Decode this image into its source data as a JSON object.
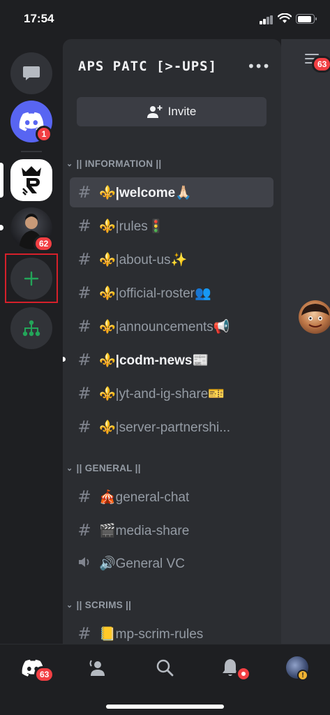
{
  "status_bar": {
    "time": "17:54"
  },
  "server_rail": {
    "servers": [
      {
        "name": "direct-messages",
        "icon": "chat-bubble-icon"
      },
      {
        "name": "discord-home",
        "icon": "discord-logo-icon",
        "badge": "1"
      },
      {
        "name": "server-logo",
        "icon": "server-logo-icon",
        "selected": true
      },
      {
        "name": "server-photo",
        "icon": "avatar",
        "badge": "62"
      }
    ],
    "add_server_icon": "plus-icon",
    "explore_icon": "hub-icon"
  },
  "server": {
    "name": "APS PATC [>-UPS]",
    "more_icon": "ellipsis-icon"
  },
  "invite": {
    "label": "Invite",
    "icon": "add-person-icon"
  },
  "categories": [
    {
      "label": "|| INFORMATION ||",
      "channels": [
        {
          "name": "⚜️|welcome🙏🏻",
          "type": "text",
          "active": true,
          "bold": true
        },
        {
          "name": "⚜️|rules🚦",
          "type": "text"
        },
        {
          "name": "⚜️|about-us✨",
          "type": "text"
        },
        {
          "name": "⚜️|official-roster👥",
          "type": "text"
        },
        {
          "name": "⚜️|announcements📢",
          "type": "text"
        },
        {
          "name": "⚜️|codm-news📰",
          "type": "text",
          "bold": true,
          "unread": true
        },
        {
          "name": "⚜️|yt-and-ig-share🎫",
          "type": "text"
        },
        {
          "name": "⚜️|server-partnershi...",
          "type": "text"
        }
      ]
    },
    {
      "label": "|| GENERAL ||",
      "channels": [
        {
          "name": "🎪general-chat",
          "type": "text"
        },
        {
          "name": "🎬media-share",
          "type": "text"
        },
        {
          "name": "🔊General VC",
          "type": "voice"
        }
      ]
    },
    {
      "label": "|| SCRIMS ||",
      "channels": [
        {
          "name": "📒mp-scrim-rules",
          "type": "text"
        }
      ]
    }
  ],
  "peek": {
    "badge": "63"
  },
  "bottom_nav": {
    "items": [
      {
        "icon": "discord-home-icon",
        "badge": "63",
        "active": true
      },
      {
        "icon": "friends-icon"
      },
      {
        "icon": "search-icon"
      },
      {
        "icon": "bell-icon",
        "dot": true
      },
      {
        "icon": "profile-avatar-icon"
      }
    ]
  },
  "colors": {
    "accent": "#5865f2",
    "badge": "#f23f43",
    "add_server": "#23a559",
    "highlight_box": "#d6202a"
  }
}
